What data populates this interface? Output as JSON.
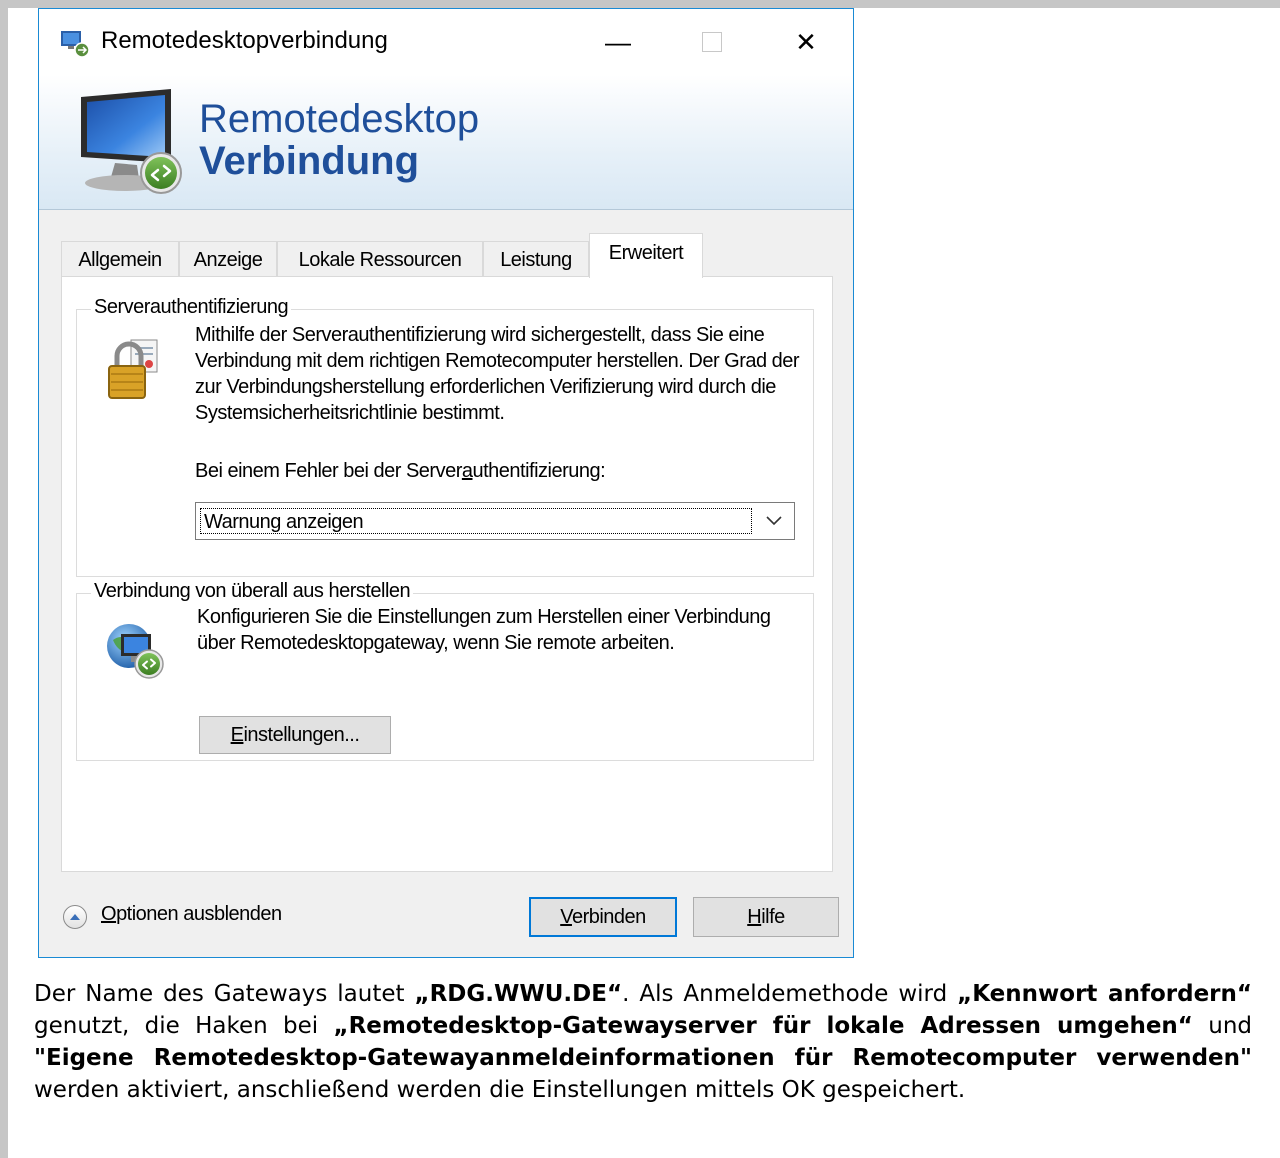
{
  "window": {
    "title": "Remotedesktopverbindung",
    "controls": {
      "minimize": "—",
      "close": "✕"
    }
  },
  "banner": {
    "line1": "Remotedesktop",
    "line2": "Verbindung"
  },
  "tabs": [
    {
      "label": "Allgemein",
      "active": false
    },
    {
      "label": "Anzeige",
      "active": false
    },
    {
      "label": "Lokale Ressourcen",
      "active": false
    },
    {
      "label": "Leistung",
      "active": false
    },
    {
      "label": "Erweitert",
      "active": true
    }
  ],
  "server_auth": {
    "group_title": "Serverauthentifizierung",
    "description": "Mithilfe der Serverauthentifizierung wird sichergestellt, dass Sie eine Verbindung mit dem richtigen Remotecomputer herstellen. Der Grad der zur Verbindungsherstellung erforderlichen Verifizierung wird durch die Systemsicherheitsrichtlinie bestimmt.",
    "failure_label_pre": "Bei einem Fehler bei der Server",
    "failure_label_access": "a",
    "failure_label_post": "uthentifizierung:",
    "selected_option": "Warnung anzeigen"
  },
  "connect_anywhere": {
    "group_title": "Verbindung von überall aus herstellen",
    "description": "Konfigurieren Sie die Einstellungen zum Herstellen einer Verbindung über Remotedesktopgateway, wenn Sie remote arbeiten.",
    "settings_button_access": "E",
    "settings_button_rest": "instellungen..."
  },
  "footer": {
    "options_access": "O",
    "options_rest": "ptionen ausblenden",
    "connect_access": "V",
    "connect_rest": "erbinden",
    "help_access": "H",
    "help_rest": "ilfe"
  },
  "instruction": {
    "t1": "Der Name des Gateways lautet ",
    "b1": "„RDG.WWU.DE“",
    "t2": ". Als Anmeldemethode wird ",
    "b2": "„Kennwort anfordern“",
    "t3": " genutzt, die Haken bei ",
    "b3": "„Remotedesktop-Gatewayserver für lokale Adressen umgehen“",
    "t4": " und ",
    "b4": "\"Eigene Remotedesktop-Gatewayanmeldeinformationen für Remotecomputer verwenden\"",
    "t5": " werden aktiviert, anschließend werden die Einstellungen mittels OK gespeichert."
  },
  "colors": {
    "window_border": "#1a8ad4",
    "banner_text": "#1f4f9a",
    "default_button_border": "#0078d7"
  }
}
